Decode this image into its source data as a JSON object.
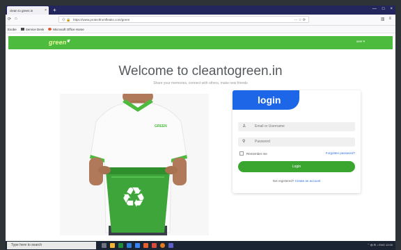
{
  "browser": {
    "tab_title": "clean to green.in",
    "tab_close": "×",
    "new_tab": "+",
    "window_controls": [
      "—",
      "□",
      "×"
    ],
    "nav_icons": [
      "⟳",
      "⌂"
    ],
    "url_prefix": "⓪ 🔒",
    "url": "https://www.protectfromfleaks.com/green",
    "url_right_icons": "··· ☆ ⟳",
    "toolbar_right_icons": [
      "▥",
      "≡"
    ],
    "bookmarks": [
      {
        "label": "Exobe",
        "color": "none"
      },
      {
        "label": "Service Desk",
        "color": "#4a4a4a"
      },
      {
        "label": "Microsoft Office Home",
        "color": "#e4572e"
      }
    ]
  },
  "site": {
    "logo_text": "green",
    "logo_leaf": "❦",
    "user_menu": "user ▾",
    "welcome": "Welcome to cleantogreen.in",
    "tagline": "Share your memories, connect with others, make new friends"
  },
  "login": {
    "title": "login",
    "email_placeholder": "Email or Username",
    "password_placeholder": "Password",
    "remember": "Remember me",
    "forgot": "Forgotten password?",
    "button": "Login",
    "register_prefix": "Not registered?",
    "register_link": "Create an account"
  },
  "hero": {
    "shirt_logo": "GREEN",
    "recycle_symbol": "♻"
  },
  "taskbar": {
    "search_placeholder": "Type here to search",
    "tray": "⌃ ◍ ✉ ♪ ENG 12:00"
  },
  "colors": {
    "brand_green": "#4dbb3e",
    "login_blue": "#1e66e8",
    "button_green": "#3aa630",
    "tab_bar": "#23265c"
  }
}
